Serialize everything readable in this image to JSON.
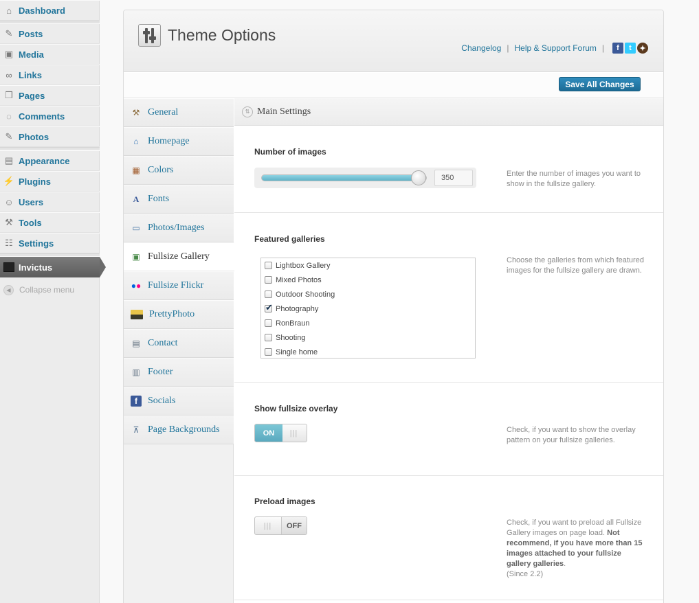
{
  "admin_menu": {
    "items": [
      {
        "label": "Dashboard",
        "icon": "dashboard-icon"
      },
      {
        "label": "Posts",
        "icon": "pushpin-icon"
      },
      {
        "label": "Media",
        "icon": "media-icon"
      },
      {
        "label": "Links",
        "icon": "link-icon"
      },
      {
        "label": "Pages",
        "icon": "pages-icon"
      },
      {
        "label": "Comments",
        "icon": "comment-icon"
      },
      {
        "label": "Photos",
        "icon": "pushpin-icon"
      },
      {
        "label": "Appearance",
        "icon": "appearance-icon"
      },
      {
        "label": "Plugins",
        "icon": "plugin-icon"
      },
      {
        "label": "Users",
        "icon": "users-icon"
      },
      {
        "label": "Tools",
        "icon": "tools-icon"
      },
      {
        "label": "Settings",
        "icon": "settings-icon"
      }
    ],
    "current": "Invictus",
    "collapse": "Collapse menu"
  },
  "header": {
    "title": "Theme Options",
    "changelog": "Changelog",
    "separator": "|",
    "support": "Help & Support Forum",
    "save": "Save All Changes"
  },
  "nav": {
    "items": [
      {
        "label": "General",
        "icon": "tools-icon"
      },
      {
        "label": "Homepage",
        "icon": "home-icon"
      },
      {
        "label": "Colors",
        "icon": "color-grid-icon"
      },
      {
        "label": "Fonts",
        "icon": "font-icon"
      },
      {
        "label": "Photos/Images",
        "icon": "images-icon"
      },
      {
        "label": "Fullsize Gallery",
        "icon": "gallery-icon"
      },
      {
        "label": "Fullsize Flickr",
        "icon": "flickr-icon"
      },
      {
        "label": "PrettyPhoto",
        "icon": "prettyphoto-icon"
      },
      {
        "label": "Contact",
        "icon": "contact-card-icon"
      },
      {
        "label": "Footer",
        "icon": "footer-icon"
      },
      {
        "label": "Socials",
        "icon": "facebook-icon"
      },
      {
        "label": "Page Backgrounds",
        "icon": "easel-icon"
      }
    ],
    "active_index": 5
  },
  "main": {
    "section_title": "Main Settings",
    "number_of_images": {
      "label": "Number of images",
      "value": "350",
      "slider_fraction": 0.95,
      "desc": "Enter the number of images you want to show in the fullsize gallery."
    },
    "featured_galleries": {
      "label": "Featured galleries",
      "options": [
        {
          "label": "Lightbox Gallery",
          "checked": false
        },
        {
          "label": "Mixed Photos",
          "checked": false
        },
        {
          "label": "Outdoor Shooting",
          "checked": false
        },
        {
          "label": "Photography",
          "checked": true
        },
        {
          "label": "RonBraun",
          "checked": false
        },
        {
          "label": "Shooting",
          "checked": false
        },
        {
          "label": "Single home",
          "checked": false
        }
      ],
      "desc": "Choose the galleries from which featured images for the fullsize gallery are drawn."
    },
    "show_overlay": {
      "label": "Show fullsize overlay",
      "state": "ON",
      "desc": "Check, if you want to show the overlay pattern on your fullsize galleries."
    },
    "preload_images": {
      "label": "Preload images",
      "state": "OFF",
      "desc_plain": "Check, if you want to preload all Fullsize Gallery images on page load.",
      "desc_bold": "Not recommend, if you have more than 15 images attached to your fullsize gallery galleries",
      "desc_end": ".",
      "desc_since": "(Since 2.2)"
    }
  }
}
